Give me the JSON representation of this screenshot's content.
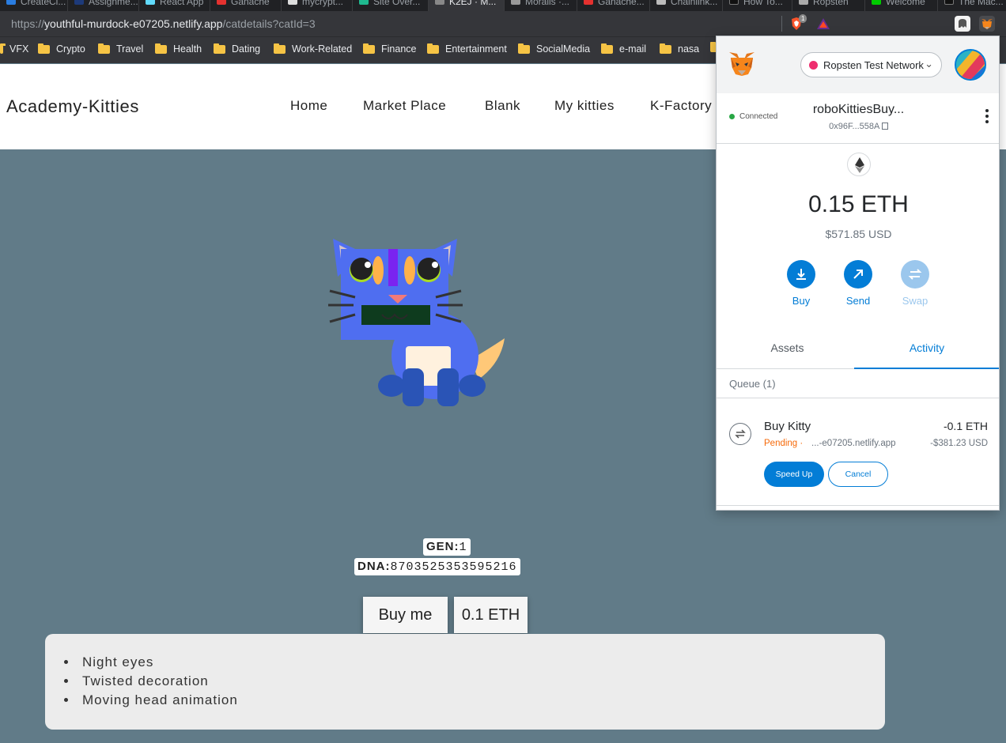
{
  "browser": {
    "tabs": [
      {
        "title": "CreateCl..."
      },
      {
        "title": "Assignme..."
      },
      {
        "title": "React App"
      },
      {
        "title": "Ganache"
      },
      {
        "title": "mycrypt..."
      },
      {
        "title": "Site Over..."
      },
      {
        "title": "K2EJ · M..."
      },
      {
        "title": "Moralis ·..."
      },
      {
        "title": "Ganache..."
      },
      {
        "title": "Chainlink..."
      },
      {
        "title": "How To..."
      },
      {
        "title": "Ropsten"
      },
      {
        "title": "Welcome"
      },
      {
        "title": "The Mac..."
      }
    ],
    "url_prefix": "https://",
    "url_host": "youthful-murdock-e07205.netlify.app",
    "url_path": "/catdetails?catId=3",
    "brave_badge": "1",
    "bookmarks": [
      "VFX",
      "Crypto",
      "Travel",
      "Health",
      "Dating",
      "Work-Related",
      "Finance",
      "Entertainment",
      "SocialMedia",
      "e-mail",
      "nasa"
    ]
  },
  "site": {
    "brand": "Academy-Kitties",
    "nav": [
      "Home",
      "Market Place",
      "Blank",
      "My kitties",
      "K-Factory"
    ]
  },
  "cat": {
    "gen_label": "GEN:",
    "gen_value": "1",
    "dna_label": "DNA:",
    "dna_value": "8703525353595216",
    "buy_label": "Buy me",
    "price": "0.1 ETH",
    "attributes": [
      "Night eyes",
      "Twisted decoration",
      "Moving head animation"
    ],
    "colors": {
      "body": "#4f6ef0",
      "ear_inner": "#d6c4c9",
      "eyes_ring": "#aadd22",
      "tail": "#ffc878",
      "belly": "#fff1de",
      "feet": "#2a54b6",
      "mouth": "#0e3b1e"
    }
  },
  "metamask": {
    "network": "Ropsten Test Network",
    "connection_status": "Connected",
    "account_name": "roboKittiesBuy...",
    "account_address": "0x96F...558A",
    "balance": "0.15 ETH",
    "balance_usd": "$571.85 USD",
    "actions": [
      "Buy",
      "Send",
      "Swap"
    ],
    "tabs": [
      "Assets",
      "Activity"
    ],
    "active_tab": "Activity",
    "queue_label": "Queue (1)",
    "transaction": {
      "title": "Buy Kitty",
      "status": "Pending ·",
      "origin": "...-e07205.netlify.app",
      "amount": "-0.1 ETH",
      "amount_usd": "-$381.23 USD",
      "speed_up": "Speed Up",
      "cancel": "Cancel"
    },
    "colors": {
      "accent": "#037dd6",
      "pending": "#f66a0a",
      "network_dot": "#ee2d6e"
    }
  }
}
